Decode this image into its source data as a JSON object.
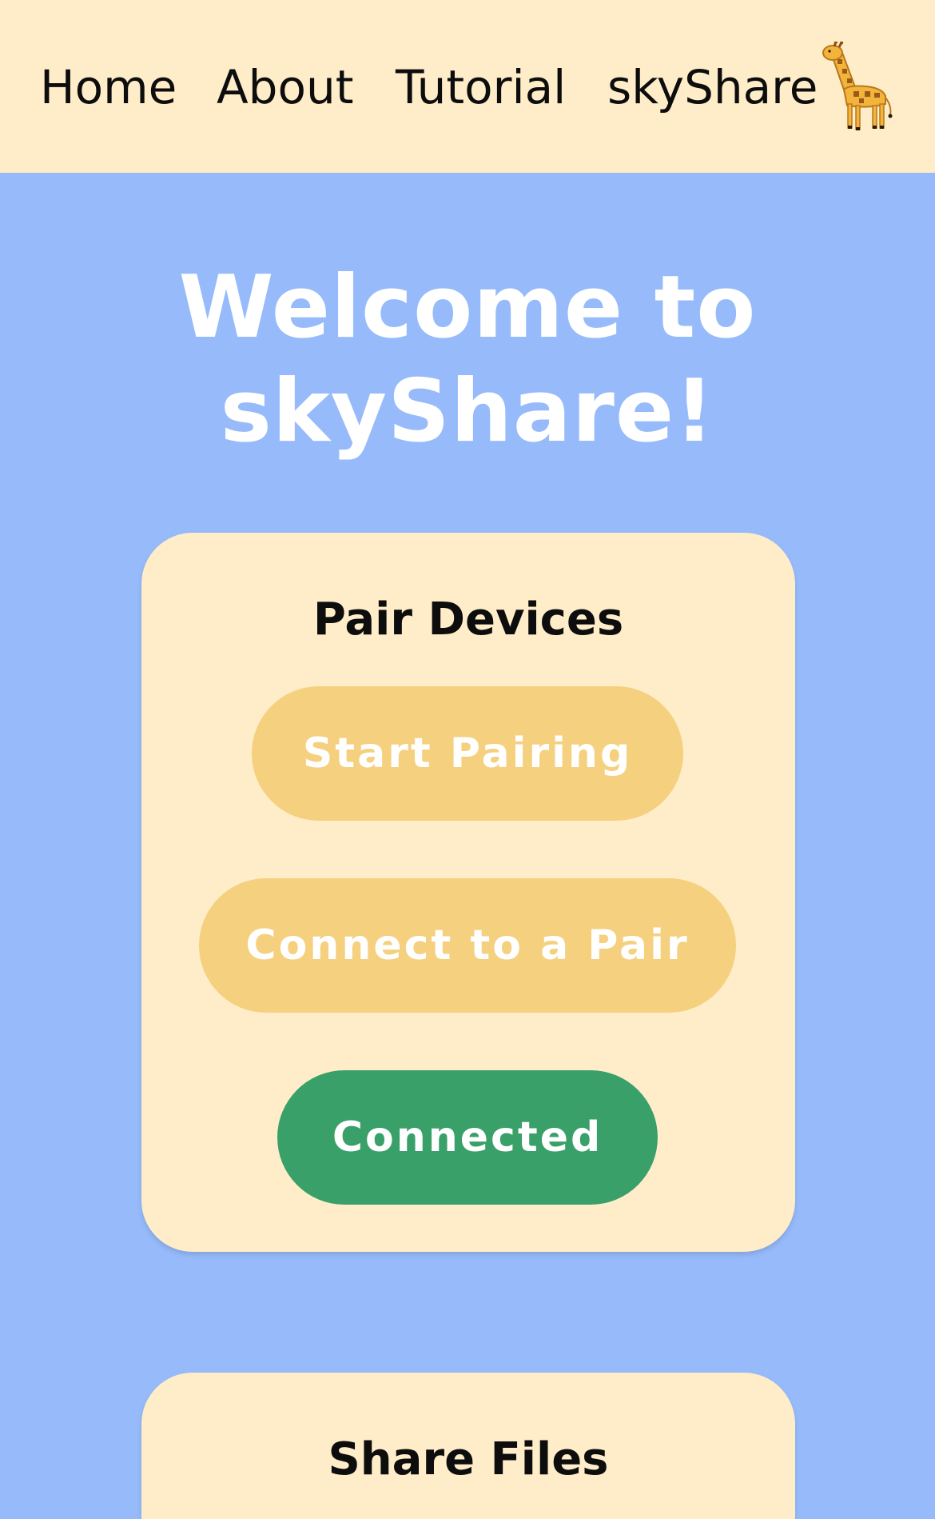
{
  "nav": {
    "home_label": "Home",
    "about_label": "About",
    "tutorial_label": "Tutorial",
    "brand_label": "skyShare",
    "brand_icon": "giraffe-icon"
  },
  "hero": {
    "title_line1": "Welcome to",
    "title_line2": "skyShare!"
  },
  "pair_card": {
    "title": "Pair Devices",
    "start_pairing_label": "Start Pairing",
    "connect_label": "Connect to a Pair",
    "status_label": "Connected"
  },
  "share_card": {
    "title": "Share Files"
  },
  "colors": {
    "background": "#97bbfa",
    "nav_bg": "#feedc8",
    "card_bg": "#feedc8",
    "button_yellow": "#f5d07f",
    "button_green": "#3aa06a",
    "text_dark": "#0d0d0d",
    "text_light": "#ffffff"
  }
}
